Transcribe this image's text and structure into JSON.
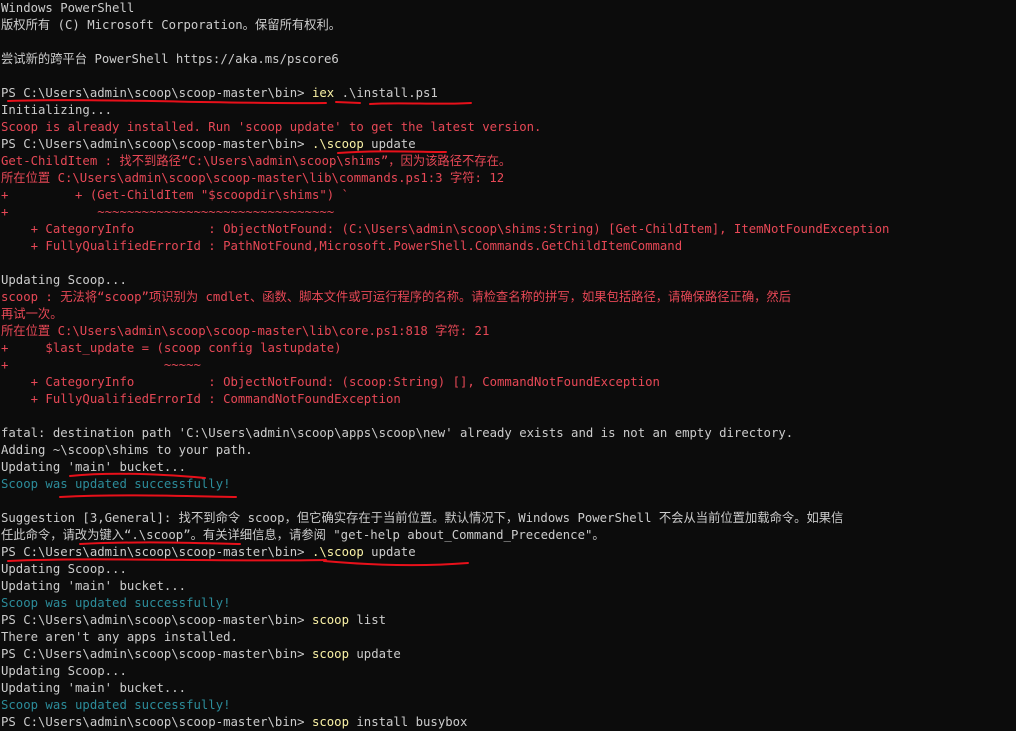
{
  "window": {
    "app": "Windows PowerShell"
  },
  "colors": {
    "background": "#0c0c0c",
    "default_text": "#cccccc",
    "error_text": "#e74856",
    "command_text": "#f9f1a5",
    "success_text": "#2c8c9a",
    "annotation": "#e8101a"
  },
  "terminal": {
    "lines": [
      {
        "segments": [
          {
            "text": "Windows PowerShell",
            "color": "def"
          }
        ]
      },
      {
        "segments": [
          {
            "text": "版权所有 (C) Microsoft Corporation。保留所有权利。",
            "color": "def"
          }
        ]
      },
      {
        "segments": [
          {
            "text": "",
            "color": "def"
          }
        ]
      },
      {
        "segments": [
          {
            "text": "尝试新的跨平台 PowerShell https://aka.ms/pscore6",
            "color": "def"
          }
        ]
      },
      {
        "segments": [
          {
            "text": "",
            "color": "def"
          }
        ]
      },
      {
        "segments": [
          {
            "text": "PS C:\\Users\\admin\\scoop\\scoop-master\\bin> ",
            "color": "def"
          },
          {
            "text": "iex",
            "color": "cmd"
          },
          {
            "text": " .\\install.ps1",
            "color": "def"
          }
        ]
      },
      {
        "segments": [
          {
            "text": "Initializing...",
            "color": "def"
          }
        ]
      },
      {
        "segments": [
          {
            "text": "Scoop is already installed. Run 'scoop update' to get the latest version.",
            "color": "err"
          }
        ]
      },
      {
        "segments": [
          {
            "text": "PS C:\\Users\\admin\\scoop\\scoop-master\\bin> ",
            "color": "def"
          },
          {
            "text": ".\\scoop",
            "color": "cmd"
          },
          {
            "text": " update",
            "color": "def"
          }
        ]
      },
      {
        "segments": [
          {
            "text": "Get-ChildItem : 找不到路径“C:\\Users\\admin\\scoop\\shims”，因为该路径不存在。",
            "color": "err"
          }
        ]
      },
      {
        "segments": [
          {
            "text": "所在位置 C:\\Users\\admin\\scoop\\scoop-master\\lib\\commands.ps1:3 字符: 12",
            "color": "err"
          }
        ]
      },
      {
        "segments": [
          {
            "text": "+         + (Get-ChildItem \"$scoopdir\\shims\") `",
            "color": "err"
          }
        ]
      },
      {
        "segments": [
          {
            "text": "+            ~~~~~~~~~~~~~~~~~~~~~~~~~~~~~~~~",
            "color": "err"
          }
        ]
      },
      {
        "segments": [
          {
            "text": "    + CategoryInfo          : ObjectNotFound: (C:\\Users\\admin\\scoop\\shims:String) [Get-ChildItem], ItemNotFoundException",
            "color": "err"
          }
        ]
      },
      {
        "segments": [
          {
            "text": "    + FullyQualifiedErrorId : PathNotFound,Microsoft.PowerShell.Commands.GetChildItemCommand",
            "color": "err"
          }
        ]
      },
      {
        "segments": [
          {
            "text": "",
            "color": "def"
          }
        ]
      },
      {
        "segments": [
          {
            "text": "Updating Scoop...",
            "color": "def"
          }
        ]
      },
      {
        "segments": [
          {
            "text": "scoop : 无法将“scoop”项识别为 cmdlet、函数、脚本文件或可运行程序的名称。请检查名称的拼写，如果包括路径，请确保路径正确，然后",
            "color": "err"
          }
        ]
      },
      {
        "segments": [
          {
            "text": "再试一次。",
            "color": "err"
          }
        ]
      },
      {
        "segments": [
          {
            "text": "所在位置 C:\\Users\\admin\\scoop\\scoop-master\\lib\\core.ps1:818 字符: 21",
            "color": "err"
          }
        ]
      },
      {
        "segments": [
          {
            "text": "+     $last_update = (scoop config lastupdate)",
            "color": "err"
          }
        ]
      },
      {
        "segments": [
          {
            "text": "+                     ~~~~~",
            "color": "err"
          }
        ]
      },
      {
        "segments": [
          {
            "text": "    + CategoryInfo          : ObjectNotFound: (scoop:String) [], CommandNotFoundException",
            "color": "err"
          }
        ]
      },
      {
        "segments": [
          {
            "text": "    + FullyQualifiedErrorId : CommandNotFoundException",
            "color": "err"
          }
        ]
      },
      {
        "segments": [
          {
            "text": "",
            "color": "def"
          }
        ]
      },
      {
        "segments": [
          {
            "text": "fatal: destination path 'C:\\Users\\admin\\scoop\\apps\\scoop\\new' already exists and is not an empty directory.",
            "color": "def"
          }
        ]
      },
      {
        "segments": [
          {
            "text": "Adding ~\\scoop\\shims to your path.",
            "color": "def"
          }
        ]
      },
      {
        "segments": [
          {
            "text": "Updating 'main' bucket...",
            "color": "def"
          }
        ]
      },
      {
        "segments": [
          {
            "text": "Scoop was updated successfully!",
            "color": "ok2"
          }
        ]
      },
      {
        "segments": [
          {
            "text": "",
            "color": "def"
          }
        ]
      },
      {
        "segments": [
          {
            "text": "Suggestion [3,General]: 找不到命令 scoop，但它确实存在于当前位置。默认情况下，Windows PowerShell 不会从当前位置加载命令。如果信",
            "color": "def"
          }
        ]
      },
      {
        "segments": [
          {
            "text": "任此命令，请改为键入“.\\scoop”。有关详细信息，请参阅 \"get-help about_Command_Precedence\"。",
            "color": "def"
          }
        ]
      },
      {
        "segments": [
          {
            "text": "PS C:\\Users\\admin\\scoop\\scoop-master\\bin> ",
            "color": "def"
          },
          {
            "text": ".\\scoop",
            "color": "cmd"
          },
          {
            "text": " update",
            "color": "def"
          }
        ]
      },
      {
        "segments": [
          {
            "text": "Updating Scoop...",
            "color": "def"
          }
        ]
      },
      {
        "segments": [
          {
            "text": "Updating 'main' bucket...",
            "color": "def"
          }
        ]
      },
      {
        "segments": [
          {
            "text": "Scoop was updated successfully!",
            "color": "ok2"
          }
        ]
      },
      {
        "segments": [
          {
            "text": "PS C:\\Users\\admin\\scoop\\scoop-master\\bin> ",
            "color": "def"
          },
          {
            "text": "scoop",
            "color": "cmd"
          },
          {
            "text": " list",
            "color": "def"
          }
        ]
      },
      {
        "segments": [
          {
            "text": "There aren't any apps installed.",
            "color": "def"
          }
        ]
      },
      {
        "segments": [
          {
            "text": "PS C:\\Users\\admin\\scoop\\scoop-master\\bin> ",
            "color": "def"
          },
          {
            "text": "scoop",
            "color": "cmd"
          },
          {
            "text": " update",
            "color": "def"
          }
        ]
      },
      {
        "segments": [
          {
            "text": "Updating Scoop...",
            "color": "def"
          }
        ]
      },
      {
        "segments": [
          {
            "text": "Updating 'main' bucket...",
            "color": "def"
          }
        ]
      },
      {
        "segments": [
          {
            "text": "Scoop was updated successfully!",
            "color": "ok2"
          }
        ]
      },
      {
        "segments": [
          {
            "text": "PS C:\\Users\\admin\\scoop\\scoop-master\\bin> ",
            "color": "def"
          },
          {
            "text": "scoop",
            "color": "cmd"
          },
          {
            "text": " install busybox",
            "color": "def"
          }
        ]
      }
    ]
  }
}
